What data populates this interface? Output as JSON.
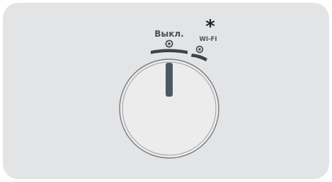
{
  "selector": {
    "positions": [
      {
        "id": "off",
        "label": "Выкл."
      },
      {
        "id": "wifi",
        "label": "WI-FI",
        "symbol": "*"
      }
    ],
    "selected": "off"
  },
  "colors": {
    "panel": "#e3e4e6",
    "knob_fill": "#ececed",
    "knob_ring": "#77797c",
    "pointer": "#4a5963",
    "marker": "#3d444a",
    "text": "#4d5257",
    "star": "#1f2226"
  },
  "icons": {
    "position_marker": "target-dot-icon",
    "wifi_symbol": "asterisk-icon"
  }
}
